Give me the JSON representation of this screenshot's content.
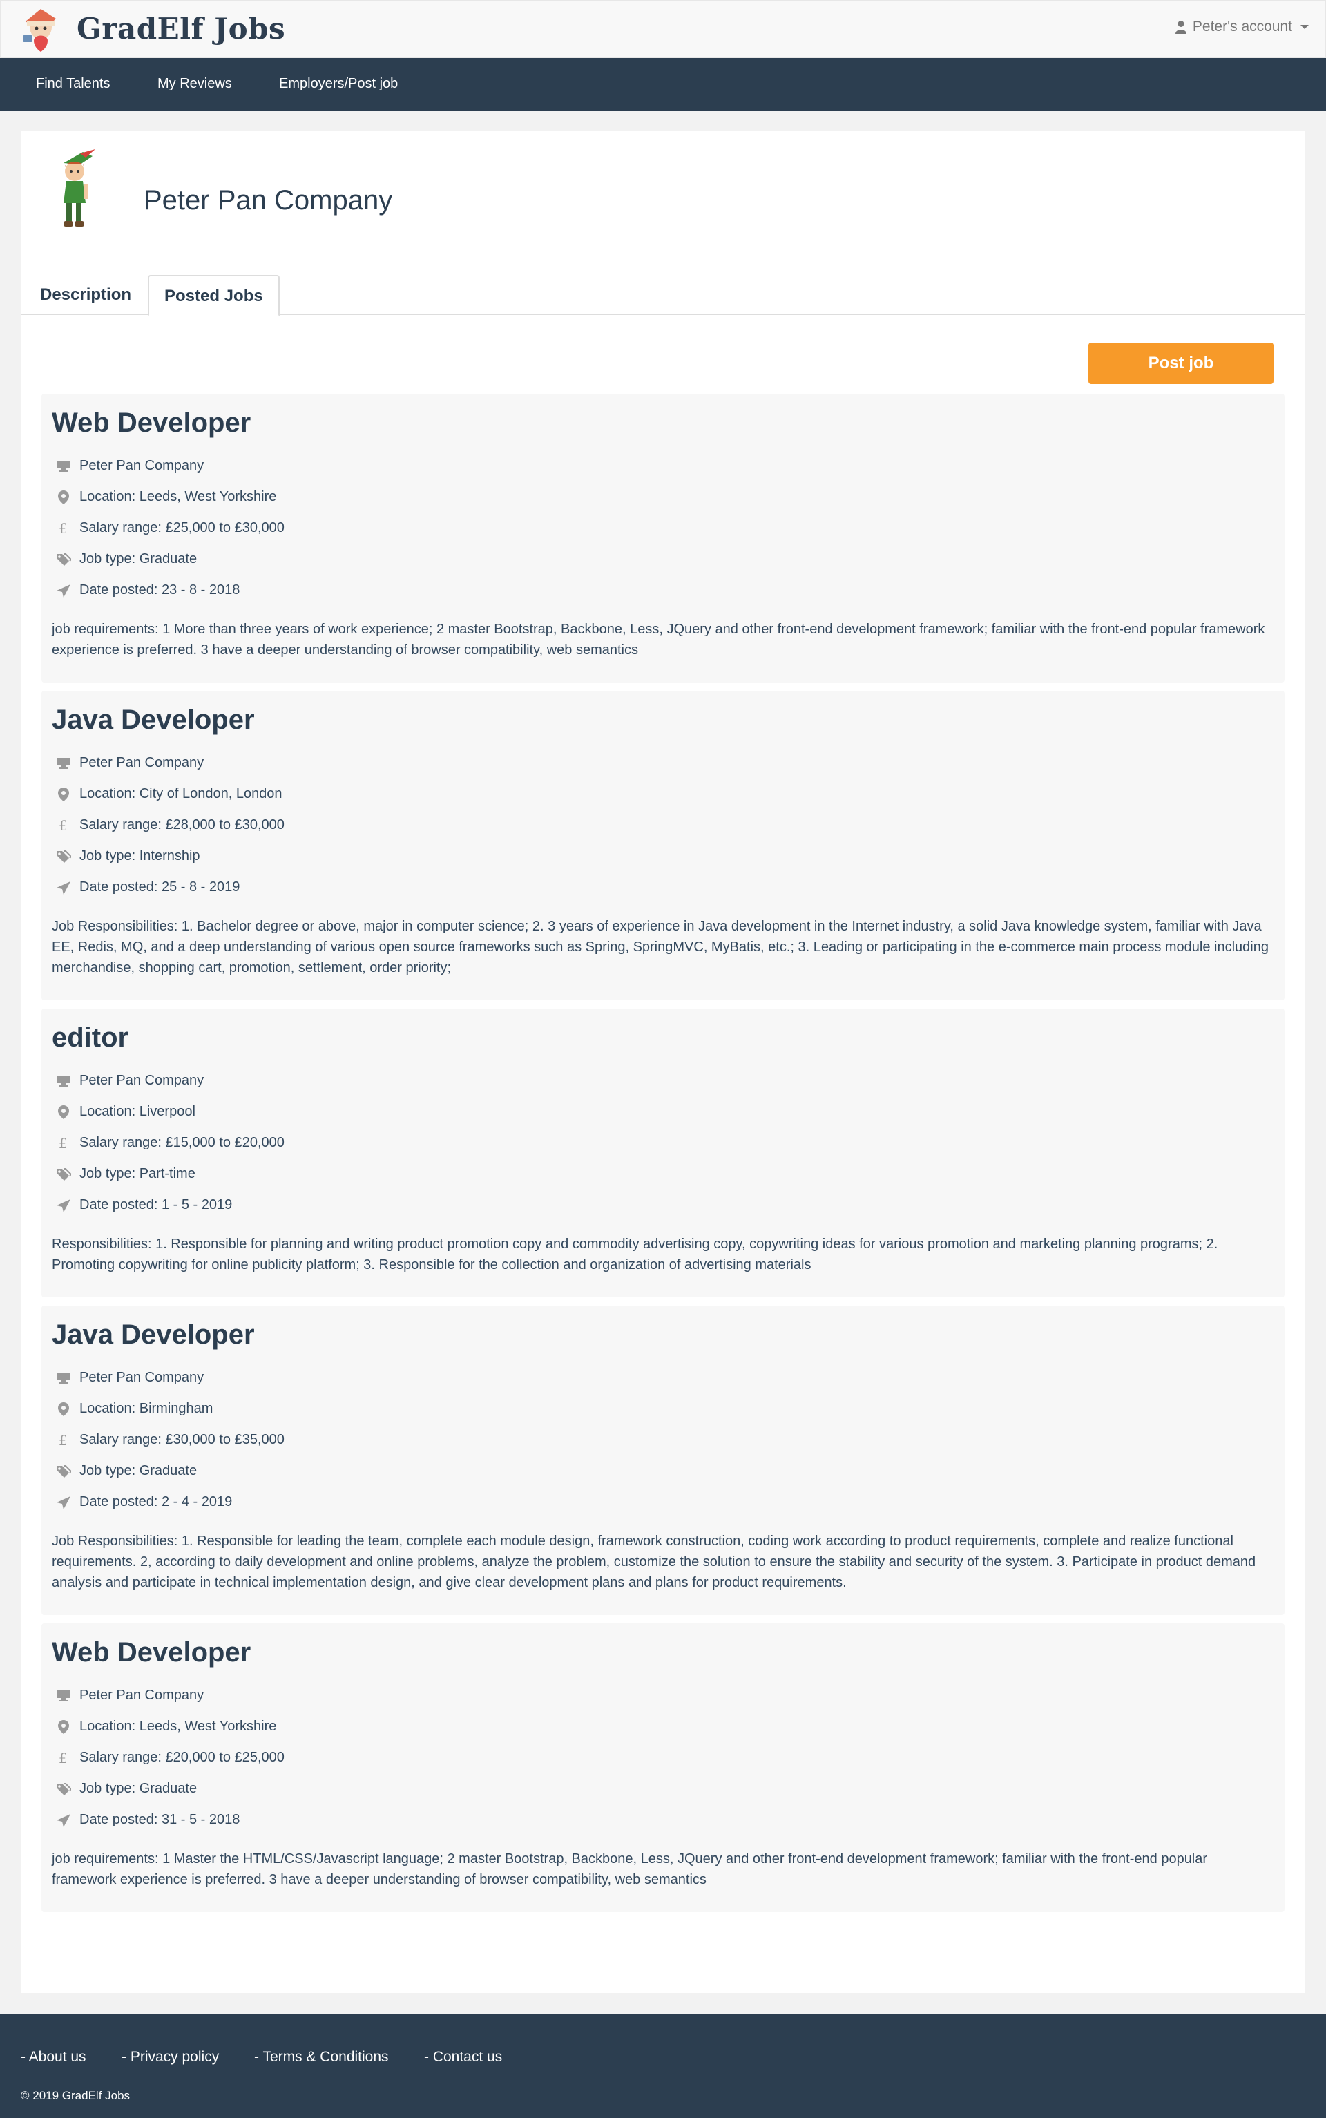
{
  "header": {
    "brand": "GradElf Jobs",
    "account_label": "Peter's account",
    "logo_icon": "elf-mascot-logo"
  },
  "nav": {
    "items": [
      {
        "label": "Find Talents"
      },
      {
        "label": "My Reviews"
      },
      {
        "label": "Employers/Post job"
      }
    ]
  },
  "company": {
    "name": "Peter Pan Company",
    "avatar_icon": "peter-pan-avatar"
  },
  "tabs": [
    {
      "label": "Description",
      "active": false
    },
    {
      "label": "Posted Jobs",
      "active": true
    }
  ],
  "post_job_label": "Post job",
  "colors": {
    "primary": "#2c3e50",
    "accent": "#f79a29",
    "card_bg": "#f7f7f7",
    "icon": "#999999"
  },
  "jobs": [
    {
      "title": "Web Developer",
      "company": "Peter Pan Company",
      "location": "Location: Leeds, West Yorkshire",
      "salary": "Salary range: £25,000 to £30,000",
      "type": "Job type: Graduate",
      "date": "Date posted: 23 - 8 - 2018",
      "description": "job requirements: 1 More than three years of work experience; 2 master Bootstrap, Backbone, Less, JQuery and other front-end development framework; familiar with the front-end popular framework experience is preferred. 3 have a deeper understanding of browser compatibility, web semantics"
    },
    {
      "title": "Java Developer",
      "company": "Peter Pan Company",
      "location": "Location: City of London, London",
      "salary": "Salary range: £28,000 to £30,000",
      "type": "Job type: Internship",
      "date": "Date posted: 25 - 8 - 2019",
      "description": "Job Responsibilities: 1. Bachelor degree or above, major in computer science; 2. 3 years of experience in Java development in the Internet industry, a solid Java knowledge system, familiar with Java EE, Redis, MQ, and a deep understanding of various open source frameworks such as Spring, SpringMVC, MyBatis, etc.; 3. Leading or participating in the e-commerce main process module including merchandise, shopping cart, promotion, settlement, order priority;"
    },
    {
      "title": "editor",
      "company": "Peter Pan Company",
      "location": "Location: Liverpool",
      "salary": "Salary range: £15,000 to £20,000",
      "type": "Job type: Part-time",
      "date": "Date posted: 1 - 5 - 2019",
      "description": "Responsibilities: 1. Responsible for planning and writing product promotion copy and commodity advertising copy, copywriting ideas for various promotion and marketing planning programs; 2. Promoting copywriting for online publicity platform; 3. Responsible for the collection and organization of advertising materials"
    },
    {
      "title": "Java Developer",
      "company": "Peter Pan Company",
      "location": "Location: Birmingham",
      "salary": "Salary range: £30,000 to £35,000",
      "type": "Job type: Graduate",
      "date": "Date posted: 2 - 4 - 2019",
      "description": "Job Responsibilities: 1. Responsible for leading the team, complete each module design, framework construction, coding work according to product requirements, complete and realize functional requirements. 2, according to daily development and online problems, analyze the problem, customize the solution to ensure the stability and security of the system. 3. Participate in product demand analysis and participate in technical implementation design, and give clear development plans and plans for product requirements."
    },
    {
      "title": "Web Developer",
      "company": "Peter Pan Company",
      "location": "Location: Leeds, West Yorkshire",
      "salary": "Salary range: £20,000 to £25,000",
      "type": "Job type: Graduate",
      "date": "Date posted: 31 - 5 - 2018",
      "description": "job requirements: 1 Master the HTML/CSS/Javascript language; 2 master Bootstrap, Backbone, Less, JQuery and other front-end development framework; familiar with the front-end popular framework experience is preferred. 3 have a deeper understanding of browser compatibility, web semantics"
    }
  ],
  "footer": {
    "links": [
      {
        "label": "- About us"
      },
      {
        "label": "- Privacy policy"
      },
      {
        "label": "- Terms & Conditions"
      },
      {
        "label": "- Contact us"
      }
    ],
    "copyright": "© 2019 GradElf Jobs"
  }
}
